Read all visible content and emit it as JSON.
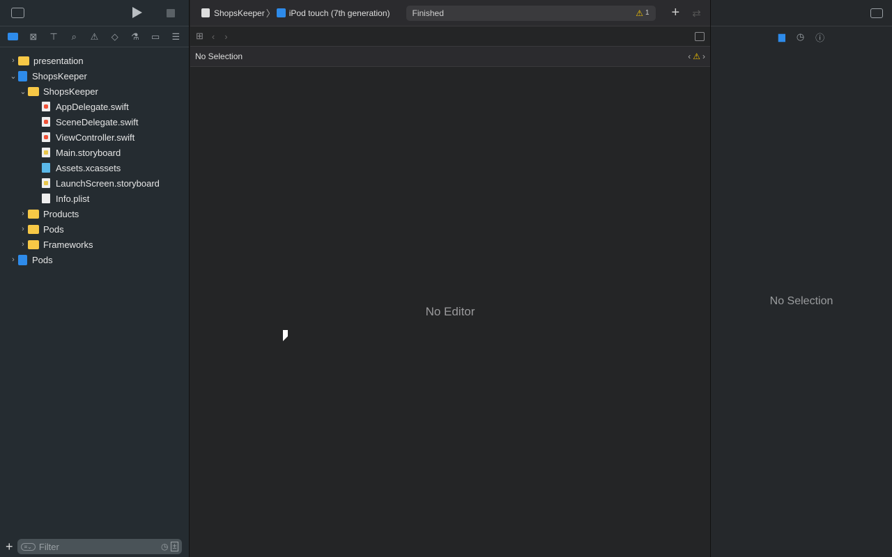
{
  "toolbar": {
    "scheme": "ShopsKeeper",
    "device": "iPod touch (7th generation)",
    "status": "Finished",
    "warning_count": "1"
  },
  "navigator": {
    "tabs": [
      "project-navigator",
      "source-control-navigator",
      "symbol-navigator",
      "find-navigator",
      "issue-navigator",
      "test-navigator",
      "debug-navigator",
      "breakpoint-navigator",
      "report-navigator"
    ],
    "tree": [
      {
        "label": "presentation",
        "type": "folder",
        "level": 0,
        "expanded": false
      },
      {
        "label": "ShopsKeeper",
        "type": "project",
        "level": 0,
        "expanded": true
      },
      {
        "label": "ShopsKeeper",
        "type": "folder",
        "level": 1,
        "expanded": true
      },
      {
        "label": "AppDelegate.swift",
        "type": "swift",
        "level": 2
      },
      {
        "label": "SceneDelegate.swift",
        "type": "swift",
        "level": 2
      },
      {
        "label": "ViewController.swift",
        "type": "swift",
        "level": 2
      },
      {
        "label": "Main.storyboard",
        "type": "storyboard",
        "level": 2
      },
      {
        "label": "Assets.xcassets",
        "type": "assets",
        "level": 2
      },
      {
        "label": "LaunchScreen.storyboard",
        "type": "storyboard",
        "level": 2
      },
      {
        "label": "Info.plist",
        "type": "plist",
        "level": 2
      },
      {
        "label": "Products",
        "type": "folder",
        "level": 1,
        "expanded": false
      },
      {
        "label": "Pods",
        "type": "folder",
        "level": 1,
        "expanded": false
      },
      {
        "label": "Frameworks",
        "type": "folder",
        "level": 1,
        "expanded": false
      },
      {
        "label": "Pods",
        "type": "project",
        "level": 0,
        "expanded": false
      }
    ],
    "filter_placeholder": "Filter"
  },
  "editor": {
    "path": "No Selection",
    "empty": "No Editor"
  },
  "inspector": {
    "empty": "No Selection"
  },
  "colors": {
    "accent": "#2e8bea",
    "warning": "#f5c400"
  }
}
